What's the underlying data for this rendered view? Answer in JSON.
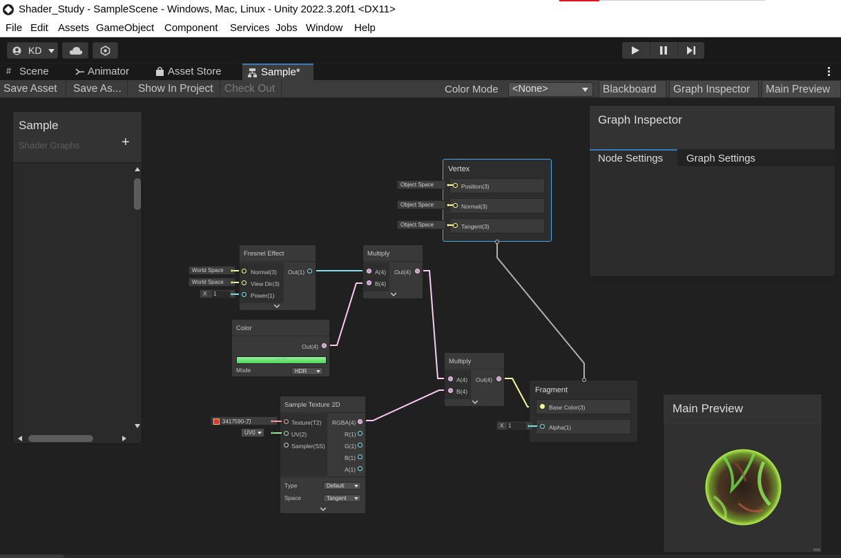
{
  "window": {
    "title": "Shader_Study - SampleScene - Windows, Mac, Linux - Unity 2022.3.20f1 <DX11>"
  },
  "menu": [
    "File",
    "Edit",
    "Assets",
    "GameObject",
    "Component",
    "Services",
    "Jobs",
    "Window",
    "Help"
  ],
  "toolbar": {
    "account": "KD"
  },
  "tabs": [
    "Scene",
    "Animator",
    "Asset Store",
    "Sample*"
  ],
  "graph_toolbar": {
    "save_asset": "Save Asset",
    "save_as": "Save As...",
    "show_in_project": "Show In Project",
    "check_out": "Check Out",
    "color_mode_label": "Color Mode",
    "color_mode_value": "<None>",
    "blackboard": "Blackboard",
    "graph_inspector": "Graph Inspector",
    "main_preview": "Main Preview"
  },
  "blackboard": {
    "title": "Sample",
    "subtitle": "Shader Graphs",
    "add": "+"
  },
  "inspector": {
    "title": "Graph Inspector",
    "tabs": [
      "Node Settings",
      "Graph Settings"
    ]
  },
  "preview": {
    "title": "Main Preview"
  },
  "nodes": {
    "vertex": {
      "title": "Vertex",
      "rows": [
        {
          "chip": "Object Space",
          "label": "Position(3)"
        },
        {
          "chip": "Object Space",
          "label": "Normal(3)"
        },
        {
          "chip": "Object Space",
          "label": "Tangent(3)"
        }
      ]
    },
    "fresnel": {
      "title": "Fresnel Effect",
      "inputs": [
        {
          "chip": "World Space",
          "label": "Normal(3)"
        },
        {
          "chip": "World Space",
          "label": "View Dir(3)"
        },
        {
          "chip_x": "X",
          "chip_val": "1",
          "label": "Power(1)"
        }
      ],
      "output": "Out(1)"
    },
    "multiply1": {
      "title": "Multiply",
      "inputs": [
        "A(4)",
        "B(4)"
      ],
      "output": "Out(4)"
    },
    "color": {
      "title": "Color",
      "output": "Out(4)",
      "hdr": "HDR",
      "mode_label": "Mode",
      "mode_value": "HDR"
    },
    "multiply2": {
      "title": "Multiply",
      "inputs": [
        "A(4)",
        "B(4)"
      ],
      "output": "Out(4)"
    },
    "sample_tex": {
      "title": "Sample Texture 2D",
      "inputs": [
        "Texture(T2)",
        "UV(2)",
        "Sampler(SS)"
      ],
      "outputs": [
        "RGBA(4)",
        "R(1)",
        "G(1)",
        "B(1)",
        "A(1)"
      ],
      "texture_chip": "3417590-刀",
      "uv_chip": "UV0",
      "type_label": "Type",
      "type_value": "Default",
      "space_label": "Space",
      "space_value": "Tangent"
    },
    "fragment": {
      "title": "Fragment",
      "rows": [
        "Base Color(3)",
        "Alpha(1)"
      ],
      "alpha_x": "X",
      "alpha_val": "1"
    }
  },
  "colors": {
    "accent": "#3a79bb",
    "selected_border": "#44a9e8",
    "wire_float": "#84e4e7",
    "wire_vec4": "#fbcbf4",
    "wire_vec3": "#f6ff9a",
    "wire_vertex": "#b0b0b0"
  }
}
